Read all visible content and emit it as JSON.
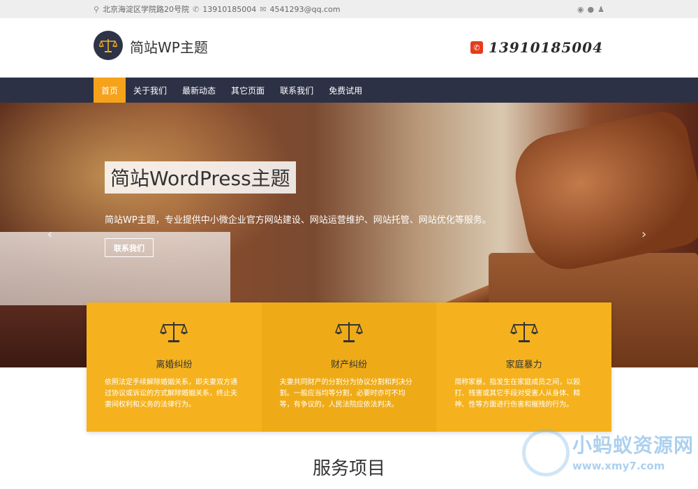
{
  "topbar": {
    "address_icon": "map-marker-icon",
    "address": "北京海淀区学院路20号院",
    "phone_icon": "phone-icon",
    "phone": "13910185004",
    "email_icon": "envelope-icon",
    "email": "4541293@qq.com",
    "social_icons": [
      "weibo-icon",
      "wechat-icon",
      "qq-icon"
    ]
  },
  "header": {
    "site_title": "简站WP主题",
    "logo_icon": "scale-icon",
    "phone_number": "13910185004",
    "phone_icon": "phone-icon",
    "phone_icon_color": "#e53c1e"
  },
  "nav": {
    "items": [
      "首页",
      "关于我们",
      "最新动态",
      "其它页面",
      "联系我们",
      "免费试用"
    ],
    "active_index": 0,
    "active_color": "#f7a21b",
    "bar_color": "#2d3146"
  },
  "hero": {
    "title": "简站WordPress主题",
    "subtitle": "简站WP主题，专业提供中小微企业官方网站建设、网站运营维护、网站托管、网站优化等服务。",
    "button": "联系我们",
    "prev_icon": "chevron-left-icon",
    "next_icon": "chevron-right-icon",
    "prev_glyph": "‹",
    "next_glyph": "›"
  },
  "features": [
    {
      "icon": "scale-icon",
      "title": "离婚纠纷",
      "desc": "依照法定手续解除婚姻关系，即夫妻双方通过协议或诉讼的方式解除婚姻关系，终止夫妻间权利和义务的法律行为。"
    },
    {
      "icon": "scale-icon",
      "title": "财产纠纷",
      "desc": "夫妻共同财产的分割分为协议分割和判决分割。一般应当均等分割，必要时亦可不均等，有争议的，人民法院应依法判决。"
    },
    {
      "icon": "scale-icon",
      "title": "家庭暴力",
      "desc": "简称家暴，指发生在家庭成员之间，以殴打、残害或其它手段对受害人从身体、精神、性等方面进行伤害和摧残的行为。"
    }
  ],
  "feature_color": "#f5b21e",
  "section": {
    "title": "服务项目"
  },
  "watermark": {
    "text": "小蚂蚁资源网",
    "url": "www.xmy7.com"
  }
}
